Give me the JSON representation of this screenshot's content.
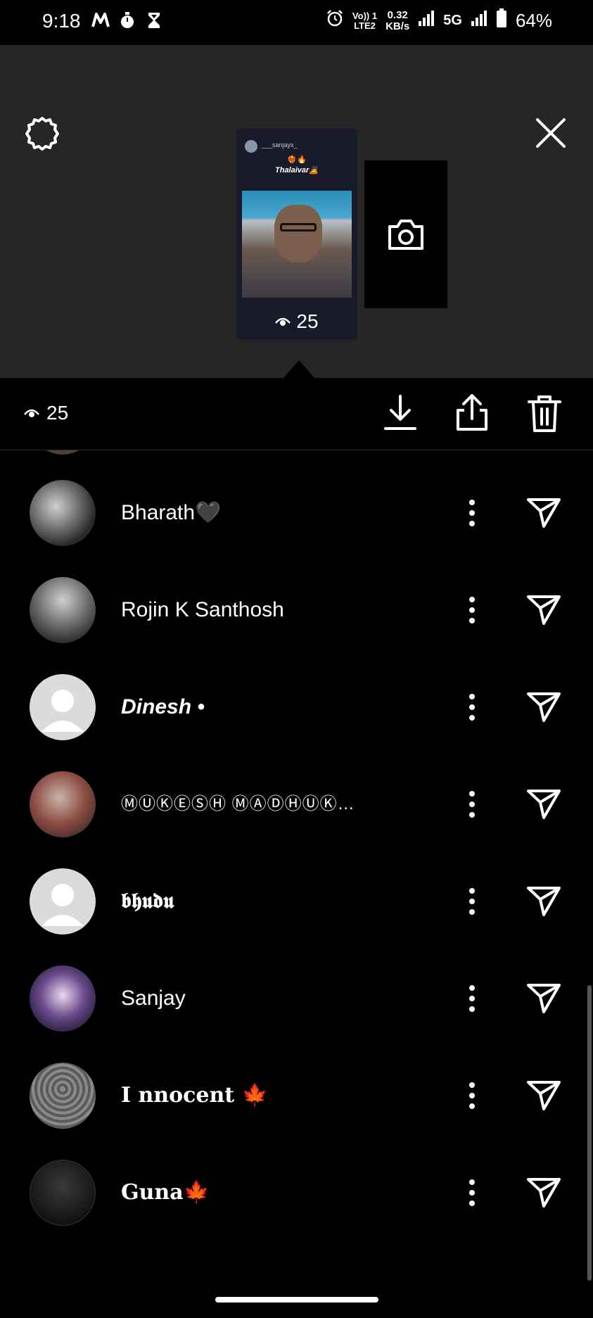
{
  "status_bar": {
    "time": "9:18",
    "network_line1": "Vo)) 1",
    "network_line2": "LTE2",
    "speed_value": "0.32",
    "speed_unit": "KB/s",
    "network_type": "5G",
    "battery": "64%",
    "icons": [
      "m-app-icon",
      "stopwatch-icon",
      "hourglass-icon",
      "alarm-icon",
      "signal-icon",
      "battery-icon"
    ]
  },
  "story_preview": {
    "username": "___sanjayx_",
    "emoji": "❤️‍🔥🔥",
    "caption": "Thalaivar🙇",
    "view_count": "25"
  },
  "action_bar": {
    "view_count": "25"
  },
  "viewers": [
    {
      "name": "Bharath🖤"
    },
    {
      "name": "Rojin K Santhosh"
    },
    {
      "name": "Dinesh •"
    },
    {
      "name": "ⓂⓊⓀⒺⓈⒽ ⓂⒶⒹⒽⓊⓀ…"
    },
    {
      "name": "𝖇𝖍𝖚𝖉𝖚"
    },
    {
      "name": "Sanjay"
    },
    {
      "name": "𝐈 𝐧𝐧𝐨𝐜𝐞𝐧𝐭 🍁"
    },
    {
      "name": "𝐆𝐮𝐧𝐚🍁"
    }
  ],
  "colors": {
    "background": "#000000",
    "preview_background": "#262626",
    "text": "#ffffff",
    "accent_blue": "#2aa4e0"
  }
}
